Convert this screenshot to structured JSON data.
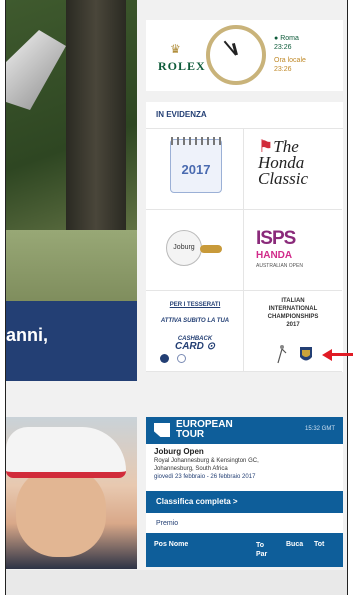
{
  "hero": {
    "caption": "anni,"
  },
  "rolex": {
    "brand": "ROLEX",
    "crown_icon": "crown-icon",
    "clock_time": "23:26",
    "city": "Roma",
    "city_time": "23:26",
    "local_label": "Ora locale",
    "local_time": "23:26"
  },
  "evidenza": {
    "title": "IN EVIDENZA",
    "cells": {
      "calendar_year": "2017",
      "honda_the": "The",
      "honda_name": "Honda",
      "honda_classic": "Classic",
      "joburg_label": "Joburg",
      "isps": "ISPS",
      "isps_handa": "HANDA",
      "isps_sub": "AUSTRALIAN OPEN",
      "tess_title": "PER I TESSERATI",
      "tess_sub": "ATTIVA SUBITO LA TUA",
      "tess_cash": "CASHBACK",
      "tess_card": "CARD",
      "iic_l1": "ITALIAN",
      "iic_l2": "INTERNATIONAL",
      "iic_l3": "CHAMPIONSHIPS",
      "iic_year": "2017"
    },
    "carousel": {
      "active_index": 0,
      "count": 2
    }
  },
  "european_tour": {
    "brand_l1": "EUROPEAN",
    "brand_l2": "TOUR",
    "time": "15:32 GMT",
    "event": "Joburg Open",
    "venue": "Royal Johannesburg & Kensington GC,",
    "location": "Johannesburg, South Africa",
    "dates": "giovedì 23 febbraio - 26 febbraio 2017",
    "button": "Classifica completa >",
    "prize_label": "Premio",
    "cols": {
      "pos_nome": "Pos Nome",
      "to_par": "To Par",
      "buca": "Buca",
      "tot": "Tot"
    }
  },
  "colors": {
    "navy": "#233f74",
    "tour_blue": "#0e5e9a",
    "rolex_green": "#0e5b3a",
    "arrow_red": "#e01b24"
  }
}
